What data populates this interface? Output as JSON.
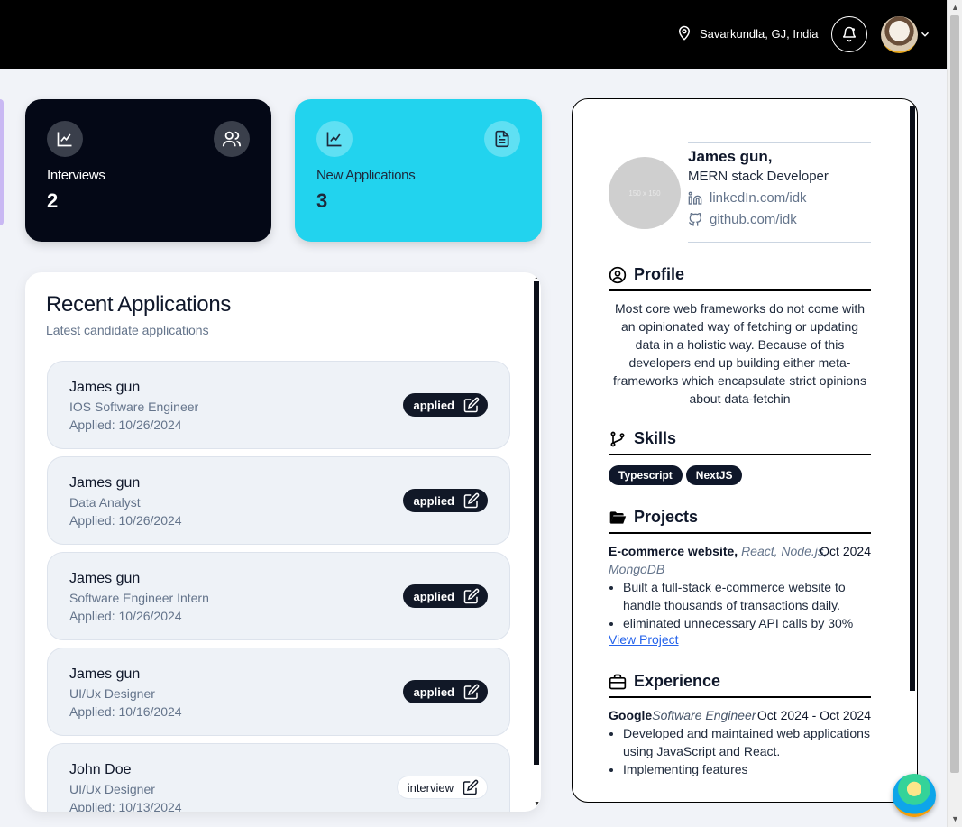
{
  "header": {
    "location": "Savarkundla, GJ, India"
  },
  "stats": [
    {
      "label": "Interviews",
      "value": "2"
    },
    {
      "label": "New Applications",
      "value": "3"
    }
  ],
  "recent": {
    "title": "Recent Applications",
    "subtitle": "Latest candidate applications",
    "items": [
      {
        "name": "James gun",
        "role": "IOS Software Engineer",
        "date": "Applied: 10/26/2024",
        "status": "applied"
      },
      {
        "name": "James gun",
        "role": "Data Analyst",
        "date": "Applied: 10/26/2024",
        "status": "applied"
      },
      {
        "name": "James gun",
        "role": "Software Engineer Intern",
        "date": "Applied: 10/26/2024",
        "status": "applied"
      },
      {
        "name": "James gun",
        "role": "UI/Ux Designer",
        "date": "Applied: 10/16/2024",
        "status": "applied"
      },
      {
        "name": "John Doe",
        "role": "UI/Ux Designer",
        "date": "Applied: 10/13/2024",
        "status": "interview"
      }
    ]
  },
  "resume": {
    "photo_placeholder": "150 x 150",
    "name": "James gun,",
    "title": "MERN stack Developer",
    "linkedin": "linkedIn.com/idk",
    "github": "github.com/idk",
    "profile_heading": "Profile",
    "profile_text": "Most core web frameworks do not come with an opinionated way of fetching or updating data in a holistic way. Because of this developers end up building either meta-frameworks which encapsulate strict opinions about data-fetchin",
    "skills_heading": "Skills",
    "skills": [
      "Typescript",
      "NextJS"
    ],
    "projects_heading": "Projects",
    "project": {
      "name": "E-commerce website,",
      "tech": "React, Node.js, MongoDB",
      "date": "Oct 2024",
      "bullets": [
        "Built a full-stack e-commerce website to handle thousands of transactions daily.",
        "eliminated unnecessary API calls by 30%"
      ],
      "link_label": "View Project"
    },
    "experience_heading": "Experience",
    "experience": {
      "company": "Google",
      "position": "Software Engineer",
      "date": "Oct 2024 - Oct 2024",
      "bullets": [
        "Developed and maintained web applications using JavaScript and React.",
        "Implementing features"
      ]
    }
  }
}
